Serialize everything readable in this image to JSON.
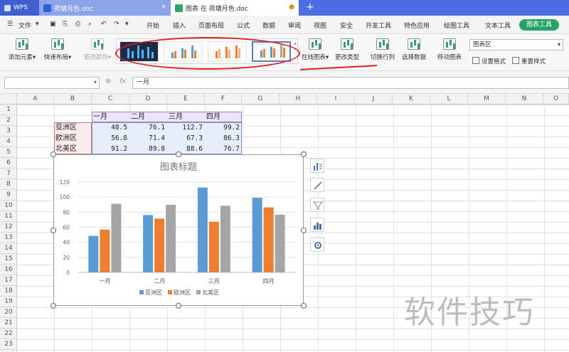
{
  "window": {
    "app_tab": "WPS",
    "doc_tab_1": "荷塘月色.doc",
    "doc_tab_2": "图表 在 荷塘月色.doc"
  },
  "menu": {
    "file": "文件",
    "items": [
      "开始",
      "插入",
      "页面布局",
      "公式",
      "数据",
      "审阅",
      "视图",
      "安全",
      "开发工具",
      "特色应用",
      "绘图工具",
      "文本工具"
    ],
    "active_tab": "图表工具"
  },
  "ribbon": {
    "add_element": "添加元素",
    "quick_layout": "快速布局",
    "change_color": "更改颜色",
    "online_chart": "在线图表",
    "change_type": "更改类型",
    "switch_row_col": "切换行列",
    "select_data": "选择数据",
    "move_chart": "移动图表",
    "chart_area": "图表区",
    "set_format": "设置格式",
    "reset_style": "重置样式"
  },
  "formula": {
    "fx": "fx",
    "value": "一月"
  },
  "grid": {
    "columns": [
      "A",
      "B",
      "C",
      "D",
      "E",
      "F",
      "G",
      "H",
      "I",
      "J",
      "K",
      "L",
      "M",
      "N",
      "O"
    ],
    "rows": [
      "1",
      "2",
      "3",
      "4",
      "5",
      "6",
      "7",
      "8",
      "9",
      "10",
      "11",
      "12",
      "13",
      "14",
      "15",
      "16",
      "17",
      "18",
      "19",
      "20",
      "21",
      "22",
      "23"
    ]
  },
  "table": {
    "headers": [
      "一月",
      "二月",
      "三月",
      "四月"
    ],
    "rows": [
      {
        "label": "亚洲区",
        "values": [
          "48.5",
          "76.1",
          "112.7",
          "99.2"
        ]
      },
      {
        "label": "欧洲区",
        "values": [
          "56.8",
          "71.4",
          "67.3",
          "86.3"
        ]
      },
      {
        "label": "北美区",
        "values": [
          "91.2",
          "89.8",
          "88.6",
          "76.7"
        ]
      }
    ]
  },
  "chart_data": {
    "type": "bar",
    "title": "图表标题",
    "categories": [
      "一月",
      "二月",
      "三月",
      "四月"
    ],
    "series": [
      {
        "name": "亚洲区",
        "values": [
          48.5,
          76.1,
          112.7,
          99.2
        ],
        "color": "#5b9bd5"
      },
      {
        "name": "欧洲区",
        "values": [
          56.8,
          71.4,
          67.3,
          86.3
        ],
        "color": "#ed7d31"
      },
      {
        "name": "北美区",
        "values": [
          91.2,
          89.8,
          88.6,
          76.7
        ],
        "color": "#a5a5a5"
      }
    ],
    "yticks": [
      "0",
      "20",
      "40",
      "60",
      "80",
      "100",
      "120"
    ],
    "ylim": [
      0,
      120
    ],
    "grid": true,
    "legend": "bottom"
  },
  "watermark": "软件技巧"
}
